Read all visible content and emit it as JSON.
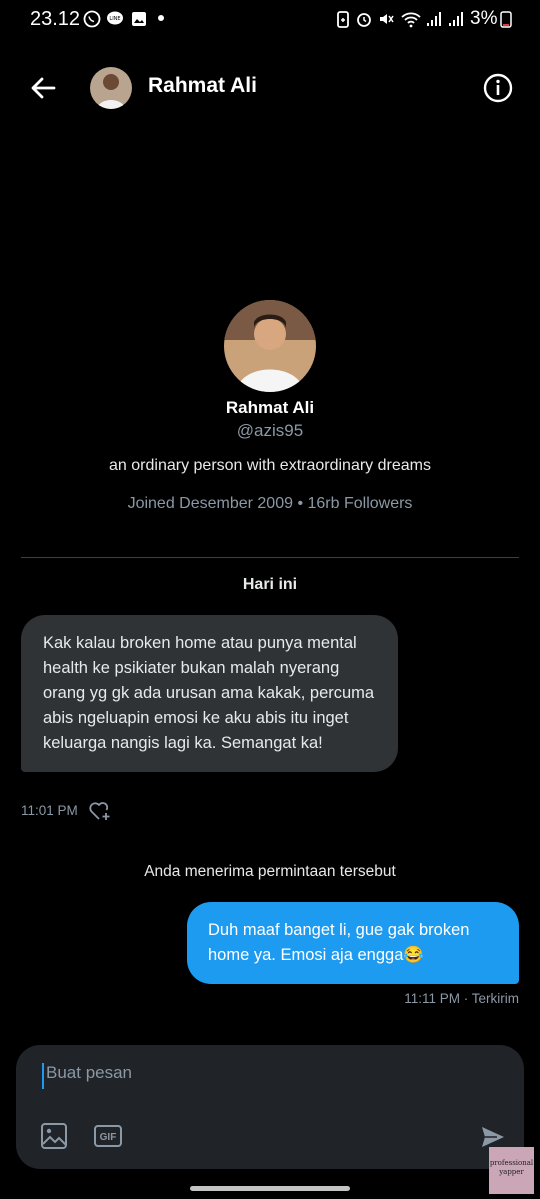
{
  "status_bar": {
    "time": "23.12",
    "battery": "3%"
  },
  "header": {
    "name": "Rahmat Ali",
    "icons": [
      "back-arrow-icon",
      "info-icon"
    ]
  },
  "profile": {
    "name": "Rahmat Ali",
    "handle": "@azis95",
    "bio": "an ordinary person with extraordinary dreams",
    "meta": "Joined Desember 2009 • 16rb Followers"
  },
  "conversation": {
    "day_label": "Hari ini",
    "incoming": {
      "text": "Kak kalau broken home atau punya mental health ke psikiater bukan malah nyerang orang yg gk ada urusan ama kakak, percuma abis ngeluapin emosi ke aku abis itu inget keluarga nangis lagi ka. Semangat ka!",
      "time": "11:01 PM"
    },
    "accepted_notice": "Anda menerima permintaan tersebut",
    "outgoing": {
      "text": "Duh maaf banget li, gue gak broken home ya. Emosi aja engga😂",
      "time": "11:11 PM · Terkirim"
    }
  },
  "composer": {
    "placeholder": "Buat pesan",
    "gif_label": "GIF"
  },
  "watermark": "professional yapper",
  "colors": {
    "accent": "#1d9bf0",
    "incoming_bubble": "#2f3336",
    "background": "#000000"
  }
}
